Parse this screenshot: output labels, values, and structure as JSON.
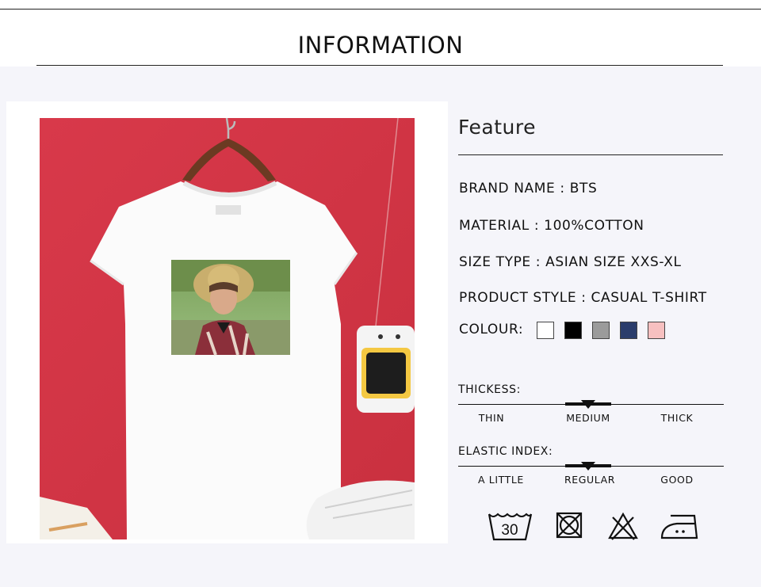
{
  "header": {
    "title": "INFORMATION"
  },
  "product_image": {
    "alt": "",
    "icon": "tshirt-photo"
  },
  "feature": {
    "title": "Feature",
    "specs": [
      {
        "label": "BRAND NAME : ",
        "value": "BTS"
      },
      {
        "label": "MATERIAL : ",
        "value": "100%COTTON"
      },
      {
        "label": "SIZE TYPE : ",
        "value": "ASIAN SIZE XXS-XL"
      },
      {
        "label": "PRODUCT STYLE : ",
        "value": "CASUAL T-SHIRT"
      }
    ],
    "colour_label": "COLOUR:",
    "colours": [
      "#ffffff",
      "#000000",
      "#9b9b9b",
      "#2b3d6b",
      "#f7c0c0"
    ]
  },
  "thickness": {
    "title": "THICKESS:",
    "options": [
      "THIN",
      "MEDIUM",
      "THICK"
    ],
    "selected": "MEDIUM"
  },
  "elastic": {
    "title": "ELASTIC INDEX:",
    "options": [
      "A LITTLE",
      "REGULAR",
      "GOOD"
    ],
    "selected": "REGULAR"
  },
  "care": {
    "wash_temperature": "30",
    "icons": [
      "wash-30-icon",
      "no-tumble-dry-icon",
      "no-bleach-icon",
      "iron-low-icon"
    ]
  }
}
